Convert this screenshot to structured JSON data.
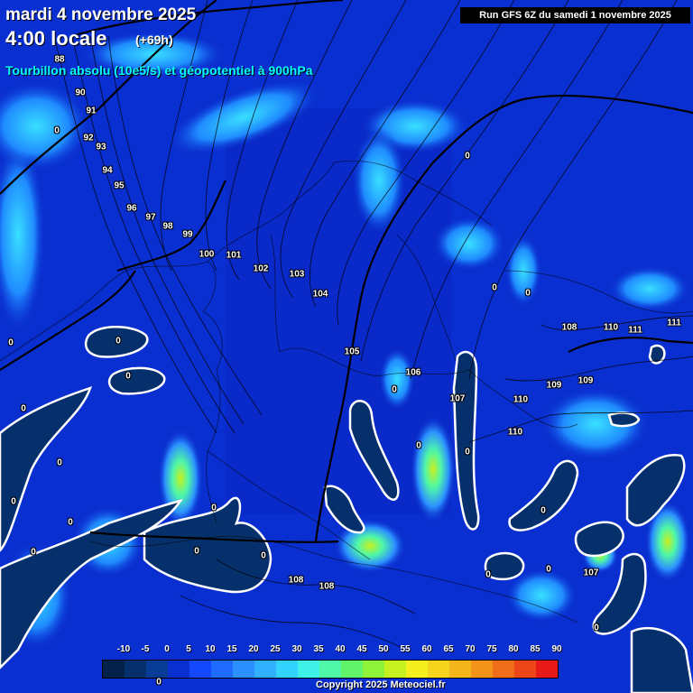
{
  "header": {
    "date": "mardi 4 novembre 2025",
    "local_time": "4:00 locale",
    "lead": "(+69h)",
    "field": "Tourbillon absolu (10e5/s) et géopotentiel à 900hPa",
    "run": "Run GFS 6Z du samedi 1 novembre 2025"
  },
  "geopotential_labels": [
    "88",
    "90",
    "91",
    "92",
    "93",
    "94",
    "95",
    "96",
    "97",
    "98",
    "99",
    "100",
    "101",
    "102",
    "103",
    "104",
    "105",
    "106",
    "107",
    "108",
    "110",
    "111",
    "109",
    "110",
    "108",
    "107",
    "108",
    "108"
  ],
  "vorticity_zero_labels": [
    "0",
    "0",
    "0",
    "0",
    "0",
    "0",
    "0",
    "0",
    "0",
    "0",
    "0",
    "0",
    "0",
    "0",
    "0",
    "0",
    "0",
    "0",
    "0",
    "0",
    "0",
    "0"
  ],
  "legend": {
    "ticks": [
      "-10",
      "-5",
      "0",
      "0",
      "5",
      "10",
      "15",
      "20",
      "25",
      "30",
      "35",
      "40",
      "45",
      "50",
      "55",
      "60",
      "65",
      "70",
      "75",
      "80",
      "85",
      "90"
    ],
    "colors": [
      "#04214a",
      "#06306b",
      "#083c96",
      "#0a2fd0",
      "#1448ff",
      "#1f6bff",
      "#2b8fff",
      "#31b0ff",
      "#33d3ff",
      "#3ff0e6",
      "#4ff7a8",
      "#61f46a",
      "#8ef23a",
      "#c7f020",
      "#f5ef1f",
      "#f6d51e",
      "#f5b61c",
      "#f3931a",
      "#f06d19",
      "#ec4619",
      "#e81a19"
    ]
  },
  "copyright": "Copyright 2025 Meteociel.fr"
}
